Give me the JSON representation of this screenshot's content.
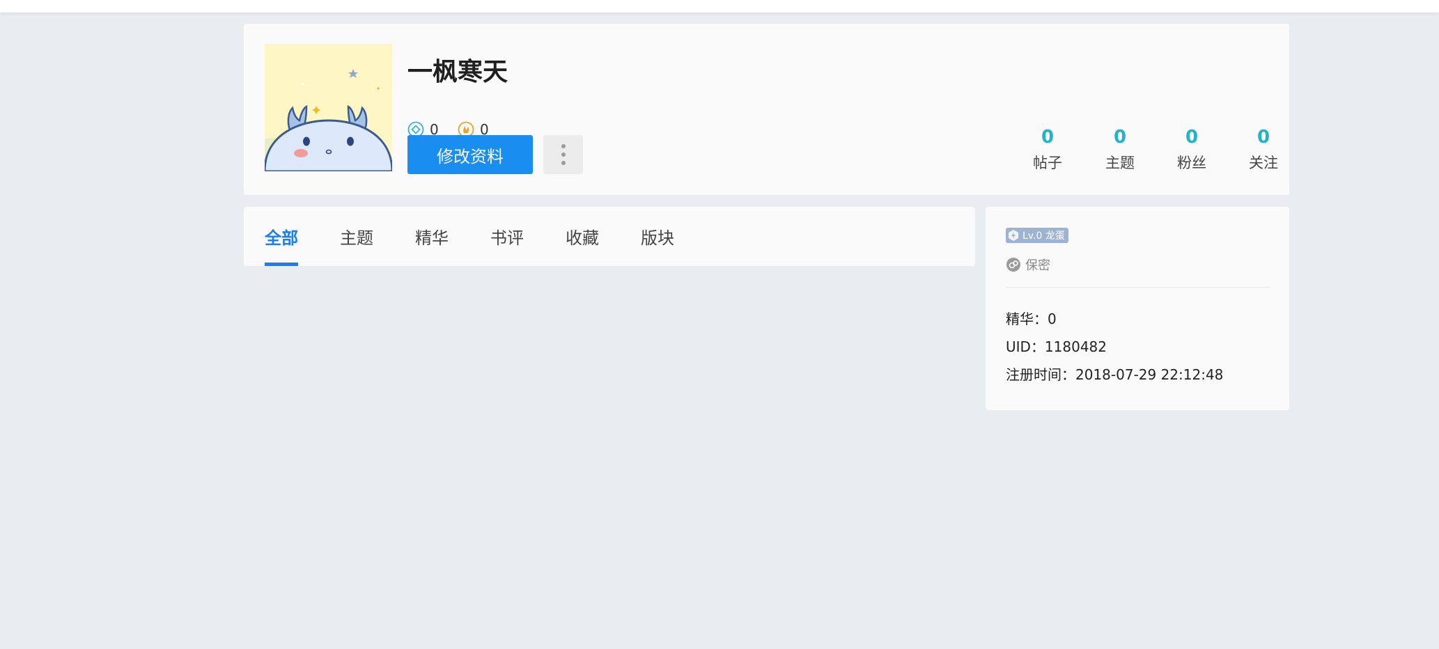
{
  "profile": {
    "username": "一枫寒天",
    "currencies": [
      {
        "icon": "diamond-icon",
        "value": "0",
        "color": "#38b2d8"
      },
      {
        "icon": "coin-icon",
        "value": "0",
        "color": "#f0a020"
      }
    ],
    "edit_button_label": "修改资料",
    "more_button_icon": "more-vertical-icon",
    "stats": [
      {
        "value": "0",
        "label": "帖子"
      },
      {
        "value": "0",
        "label": "主题"
      },
      {
        "value": "0",
        "label": "粉丝"
      },
      {
        "value": "0",
        "label": "关注"
      }
    ]
  },
  "tabs": [
    {
      "label": "全部",
      "active": true
    },
    {
      "label": "主题",
      "active": false
    },
    {
      "label": "精华",
      "active": false
    },
    {
      "label": "书评",
      "active": false
    },
    {
      "label": "收藏",
      "active": false
    },
    {
      "label": "版块",
      "active": false
    }
  ],
  "info": {
    "level_badge": "Lv.0 龙蛋",
    "gender": "保密",
    "digest": "精华：0",
    "uid": "UID：1180482",
    "register_time": "注册时间：2018-07-29 22:12:48"
  },
  "colors": {
    "accent": "#1a7ef0",
    "button": "#1a8df0",
    "stat_number": "#23b3c9",
    "page_bg": "#e9ecf1"
  }
}
